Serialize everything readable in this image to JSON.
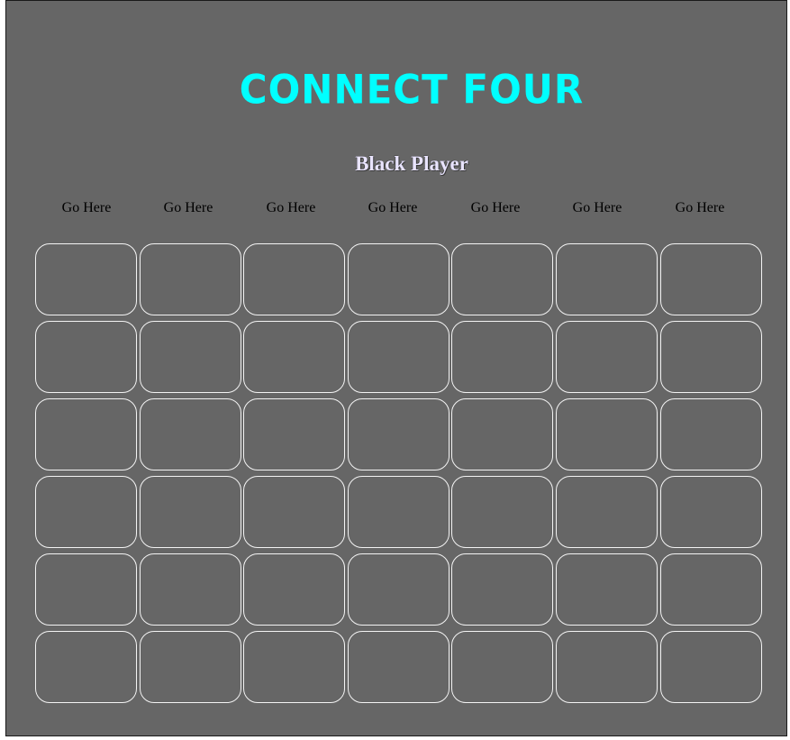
{
  "game": {
    "title": "Connect Four",
    "current_player": "Black Player",
    "drop_label": "Go Here",
    "columns": 7,
    "rows": 6,
    "colors": {
      "background": "#666666",
      "title": "#00ffff",
      "cell_border": "#f3f3f3",
      "player_text": "#e9e4ff"
    },
    "board": [
      [
        "",
        "",
        "",
        "",
        "",
        "",
        ""
      ],
      [
        "",
        "",
        "",
        "",
        "",
        "",
        ""
      ],
      [
        "",
        "",
        "",
        "",
        "",
        "",
        ""
      ],
      [
        "",
        "",
        "",
        "",
        "",
        "",
        ""
      ],
      [
        "",
        "",
        "",
        "",
        "",
        "",
        ""
      ],
      [
        "",
        "",
        "",
        "",
        "",
        "",
        ""
      ]
    ]
  }
}
